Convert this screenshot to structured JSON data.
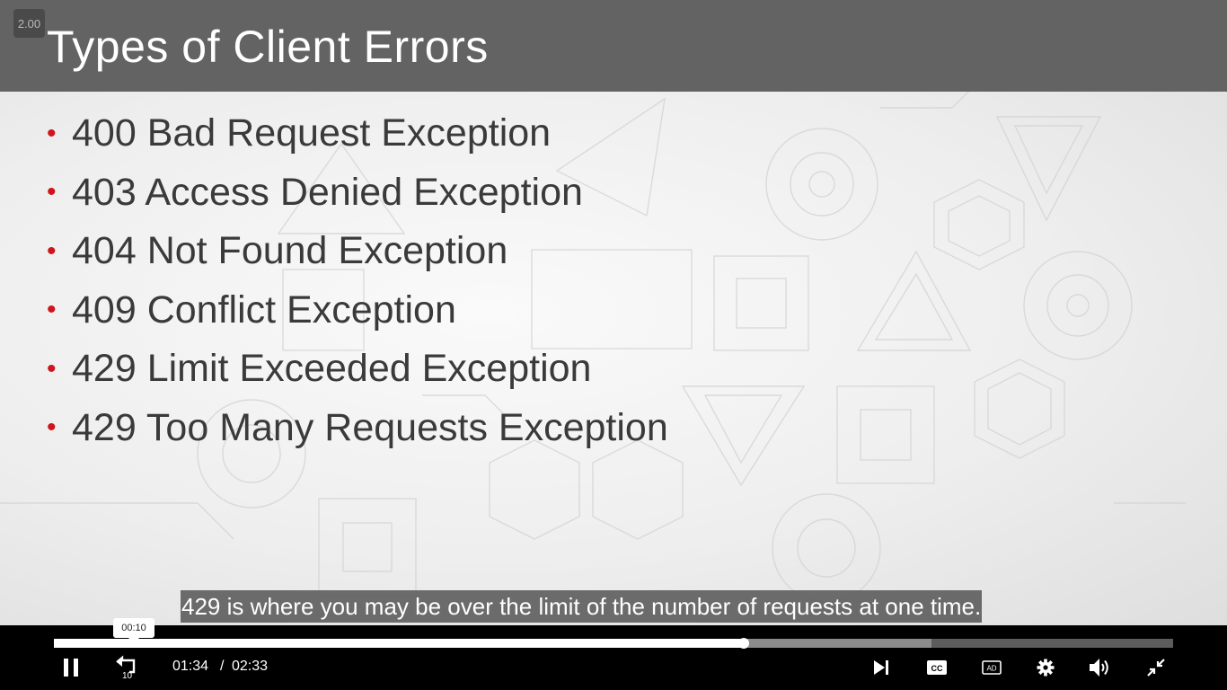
{
  "slide": {
    "title": "Types of Client Errors",
    "bullets": [
      "400 Bad Request Exception",
      "403 Access Denied Exception",
      "404 Not Found Exception",
      "409 Conflict Exception",
      "429 Limit Exceeded Exception",
      "429 Too Many Requests Exception"
    ],
    "bullet_color": "#d0141c",
    "title_bar_color": "#636363"
  },
  "player": {
    "speed": "2.00",
    "caption": "429 is where you may be over the limit of the number of requests at one time.",
    "hover_time": "00:10",
    "current_time": "01:34",
    "time_separator": "/",
    "total_time": "02:33",
    "played_fraction": 0.616,
    "buffered_fraction": 0.784,
    "icons": {
      "play_pause": "pause-icon",
      "rewind": "rewind-10-icon",
      "rewind_label": "10",
      "next": "skip-next-icon",
      "captions": "closed-captions-icon",
      "captions_label": "CC",
      "audio_description": "audio-description-icon",
      "audio_description_label": "AD",
      "settings": "gear-icon",
      "volume": "volume-icon",
      "fullscreen": "exit-fullscreen-icon"
    }
  }
}
